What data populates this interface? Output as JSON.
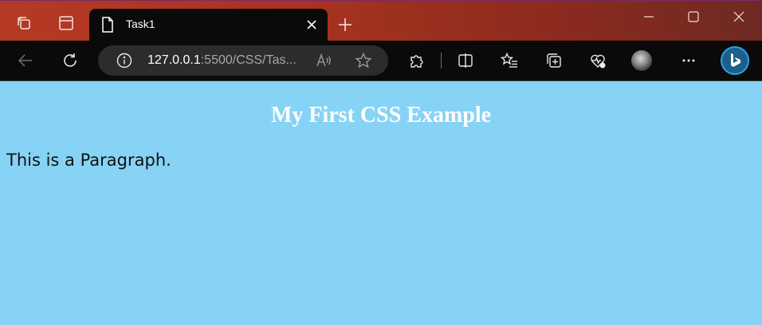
{
  "browser": {
    "tab_title": "Task1",
    "url_host": "127.0.0.1",
    "url_rest": ":5500/CSS/Tas...",
    "icons": {
      "workspaces": "workspaces-icon",
      "tab_actions": "tab-actions-icon",
      "page": "page-icon",
      "close_tab": "close-icon",
      "new_tab": "plus-icon",
      "minimize": "minimize-icon",
      "maximize": "maximize-icon",
      "close_window": "close-window-icon",
      "back": "back-arrow-icon",
      "refresh": "refresh-icon",
      "site_info": "info-icon",
      "read_aloud": "read-aloud-icon",
      "favorite": "star-icon",
      "extensions": "puzzle-icon",
      "split_screen": "split-screen-icon",
      "favorites": "favorites-list-icon",
      "collections": "collections-icon",
      "browser_essentials": "heart-pulse-icon",
      "profile": "avatar",
      "more": "more-icon",
      "copilot": "bing-icon"
    },
    "colors": {
      "titlebar": "#b53a25",
      "toolbar": "#0c0a08",
      "page_background": "#87d3f5"
    }
  },
  "page": {
    "heading": "My First CSS Example",
    "paragraph": "This is a Paragraph."
  }
}
